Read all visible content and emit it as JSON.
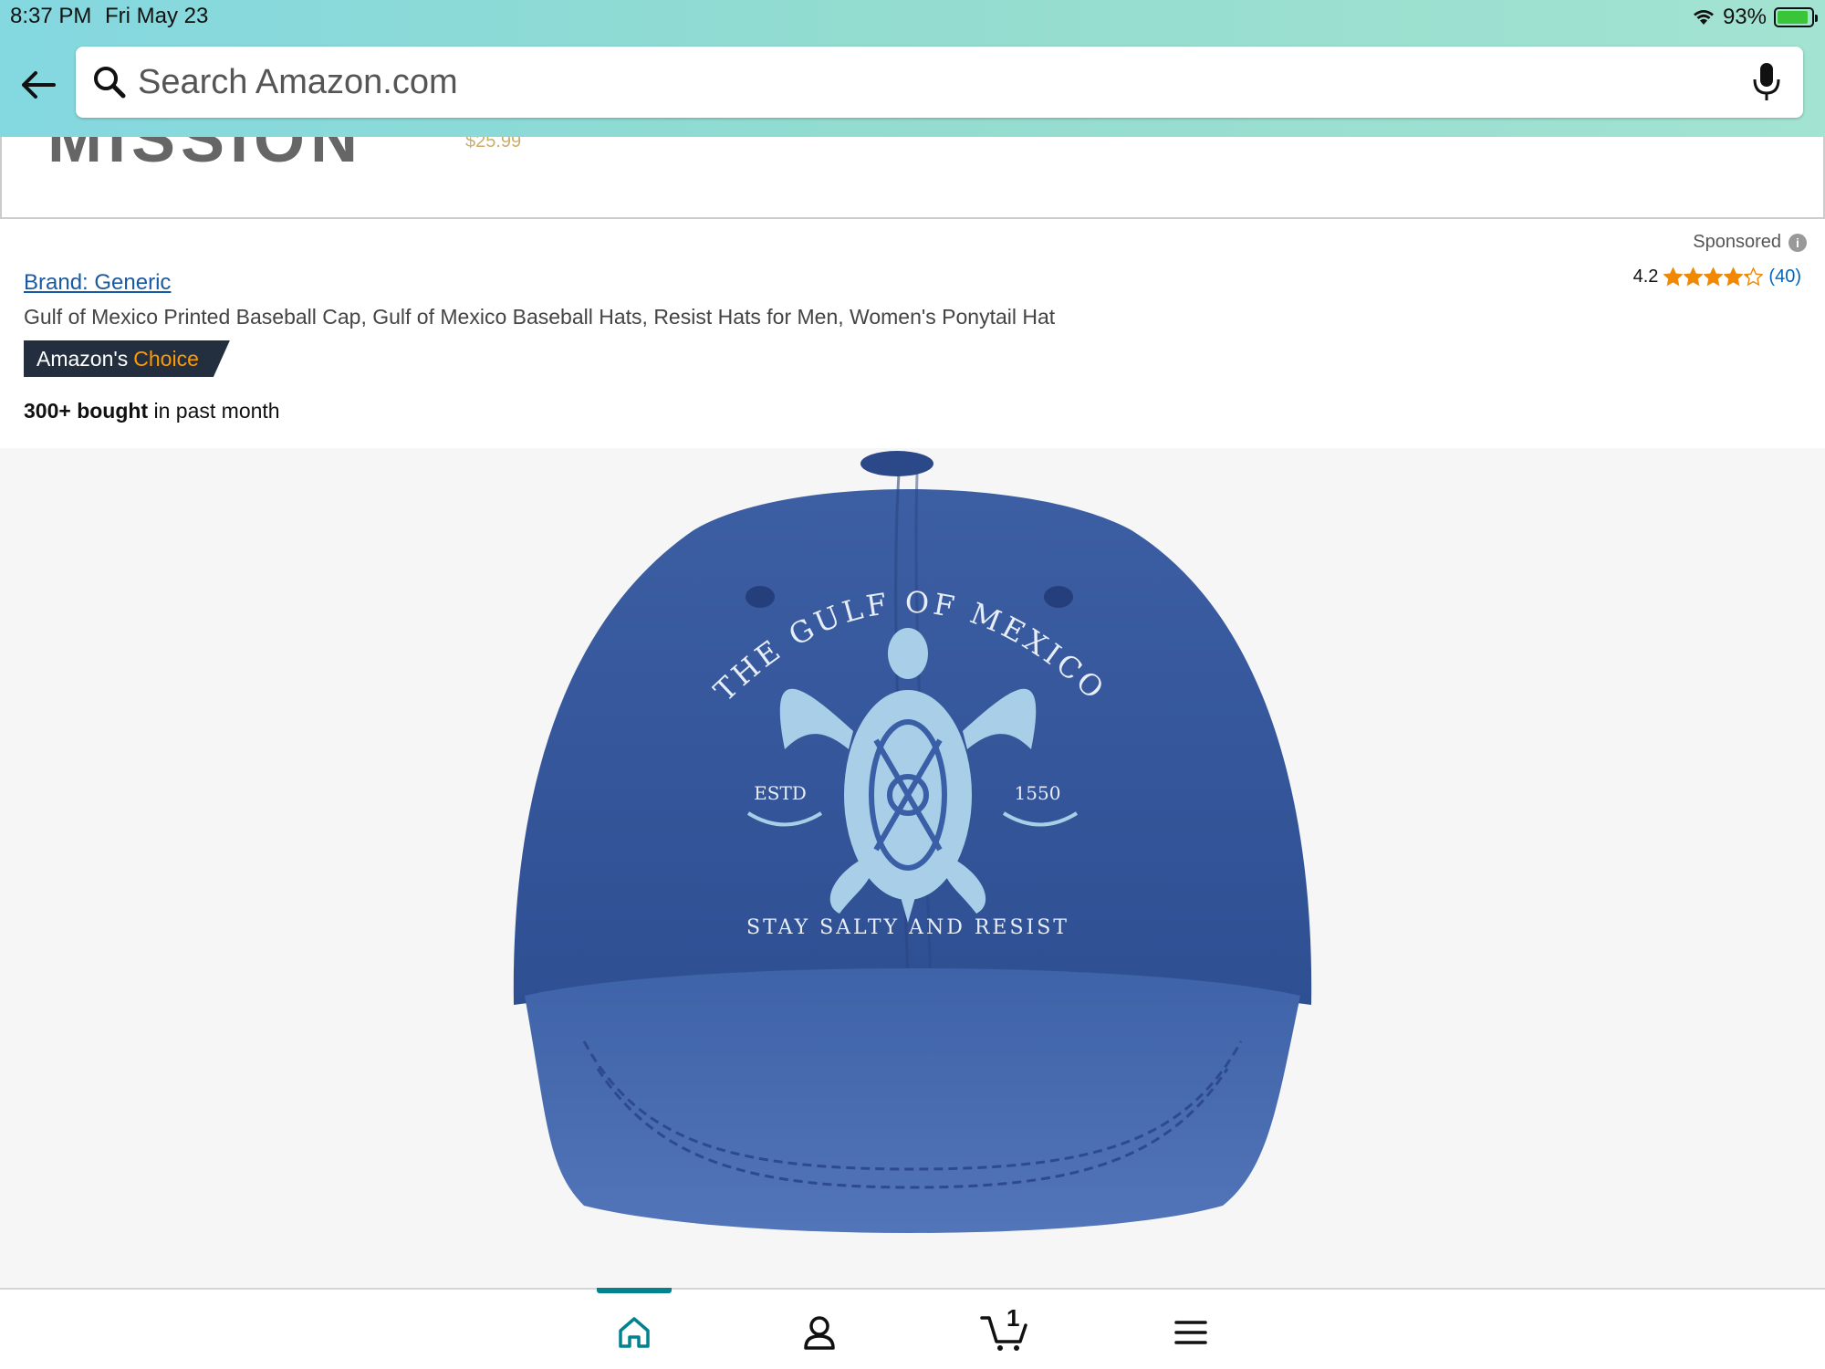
{
  "status_bar": {
    "time": "8:37 PM",
    "date": "Fri May 23",
    "battery": "93%",
    "battery_level": 0.93
  },
  "search": {
    "placeholder": "Search Amazon.com"
  },
  "previous_result": {
    "logo_text": "MISSION",
    "price_text": "$25.99"
  },
  "product": {
    "sponsored_label": "Sponsored",
    "rating_value": "4.2",
    "rating_stars": 4.2,
    "rating_count": "(40)",
    "brand": "Brand: Generic",
    "title": "Gulf of Mexico Printed Baseball Cap, Gulf of Mexico Baseball Hats, Resist Hats for Men, Women's Ponytail Hat",
    "badge_prefix": "Amazon's",
    "badge_highlight": "Choice",
    "bought_strong": "300+ bought",
    "bought_rest": " in past month"
  },
  "hat_image": {
    "arc_text": "THE GULF OF MEXICO",
    "left_text": "ESTD",
    "right_text": "1550",
    "bottom_text": "STAY SALTY AND RESIST"
  },
  "bottom_nav": {
    "cart_count": "1",
    "items": [
      "home-icon",
      "account-icon",
      "cart-icon",
      "menu-icon"
    ]
  },
  "colors": {
    "header_gradient_start": "#84d8e0",
    "header_gradient_end": "#a3e3d2",
    "badge_background": "#232f3e",
    "badge_highlight": "#ff9900",
    "star_color": "#f08804",
    "link_color": "#1a5aa4",
    "nav_active": "#00838f",
    "hat_denim": "#3a5fa6"
  }
}
